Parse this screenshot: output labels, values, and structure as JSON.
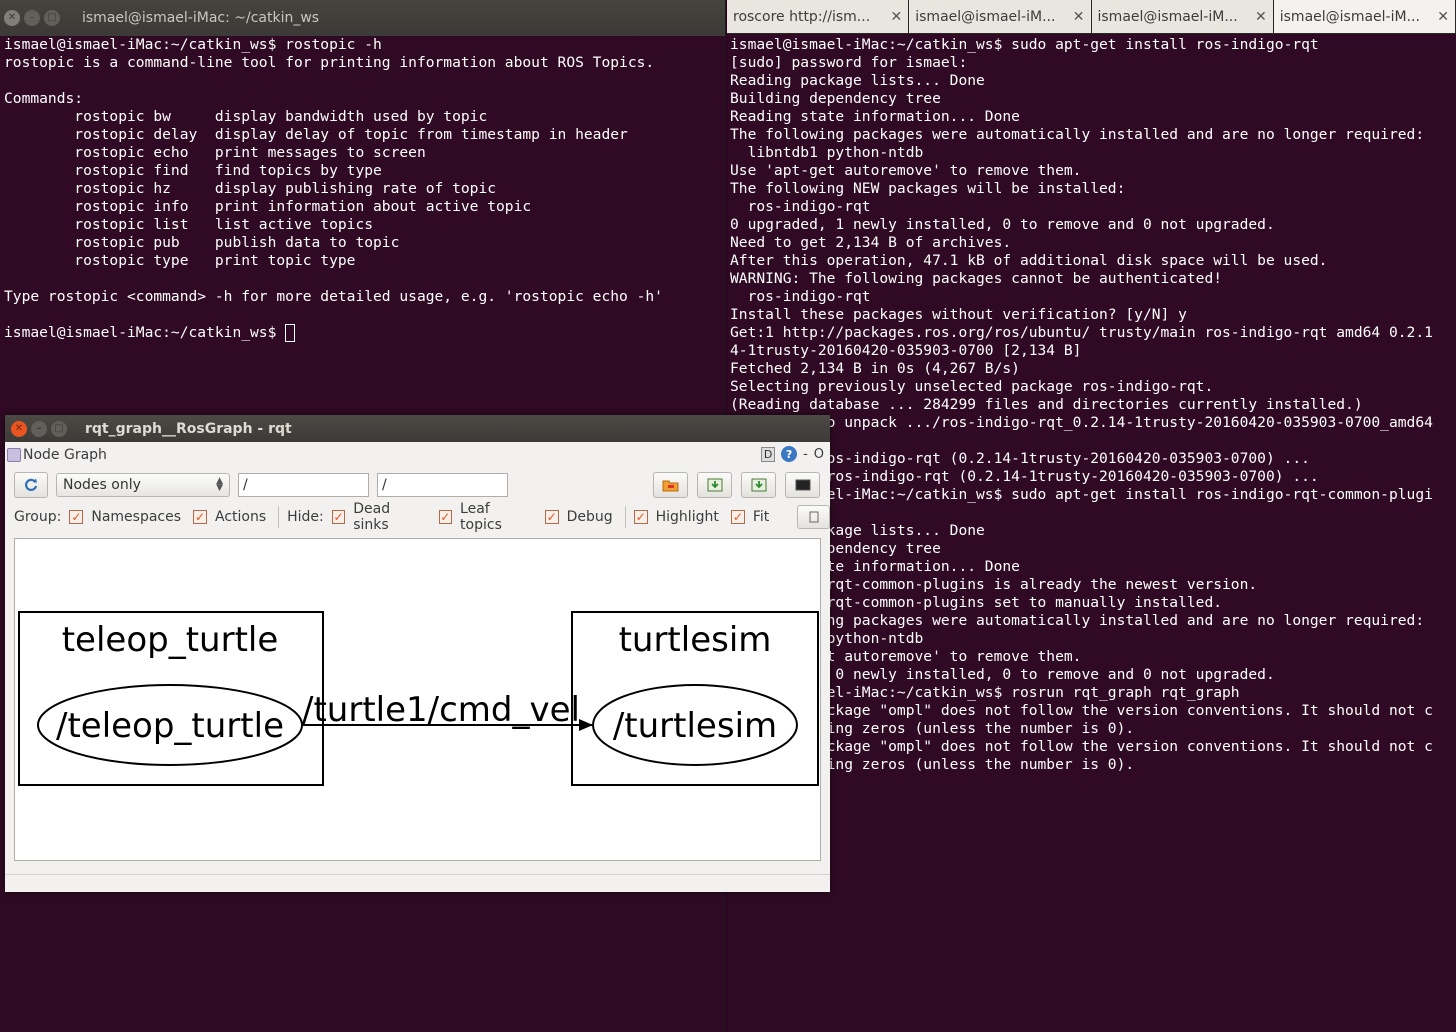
{
  "left_terminal": {
    "title": "ismael@ismael-iMac: ~/catkin_ws",
    "lines": [
      "ismael@ismael-iMac:~/catkin_ws$ rostopic -h",
      "rostopic is a command-line tool for printing information about ROS Topics.",
      "",
      "Commands:",
      "\trostopic bw\tdisplay bandwidth used by topic",
      "\trostopic delay\tdisplay delay of topic from timestamp in header",
      "\trostopic echo\tprint messages to screen",
      "\trostopic find\tfind topics by type",
      "\trostopic hz\tdisplay publishing rate of topic",
      "\trostopic info\tprint information about active topic",
      "\trostopic list\tlist active topics",
      "\trostopic pub\tpublish data to topic",
      "\trostopic type\tprint topic type",
      "",
      "Type rostopic <command> -h for more detailed usage, e.g. 'rostopic echo -h'",
      ""
    ],
    "prompt": "ismael@ismael-iMac:~/catkin_ws$ "
  },
  "right_terminal": {
    "tabs": [
      {
        "label": "roscore http://ism..."
      },
      {
        "label": "ismael@ismael-iM..."
      },
      {
        "label": "ismael@ismael-iM..."
      },
      {
        "label": "ismael@ismael-iM..."
      }
    ],
    "lines": [
      "ismael@ismael-iMac:~/catkin_ws$ sudo apt-get install ros-indigo-rqt",
      "[sudo] password for ismael:",
      "Reading package lists... Done",
      "Building dependency tree",
      "Reading state information... Done",
      "The following packages were automatically installed and are no longer required:",
      "  libntdb1 python-ntdb",
      "Use 'apt-get autoremove' to remove them.",
      "The following NEW packages will be installed:",
      "  ros-indigo-rqt",
      "0 upgraded, 1 newly installed, 0 to remove and 0 not upgraded.",
      "Need to get 2,134 B of archives.",
      "After this operation, 47.1 kB of additional disk space will be used.",
      "WARNING: The following packages cannot be authenticated!",
      "  ros-indigo-rqt",
      "Install these packages without verification? [y/N] y",
      "Get:1 http://packages.ros.org/ros/ubuntu/ trusty/main ros-indigo-rqt amd64 0.2.1",
      "4-1trusty-20160420-035903-0700 [2,134 B]",
      "Fetched 2,134 B in 0s (4,267 B/s)",
      "Selecting previously unselected package ros-indigo-rqt.",
      "(Reading database ... 284299 files and directories currently installed.)",
      "Preparing to unpack .../ros-indigo-rqt_0.2.14-1trusty-20160420-035903-0700_amd64",
      "",
      "Unpacking ros-indigo-rqt (0.2.14-1trusty-20160420-035903-0700) ...",
      "Setting up ros-indigo-rqt (0.2.14-1trusty-20160420-035903-0700) ...",
      "ismael@ismael-iMac:~/catkin_ws$ sudo apt-get install ros-indigo-rqt-common-plugi",
      "",
      "Reading package lists... Done",
      "Building dependency tree",
      "Reading state information... Done",
      "ros-indigo-rqt-common-plugins is already the newest version.",
      "ros-indigo-rqt-common-plugins set to manually installed.",
      "The following packages were automatically installed and are no longer required:",
      "  libntdb1 python-ntdb",
      "Use 'apt-get autoremove' to remove them.",
      "0 upgraded, 0 newly installed, 0 to remove and 0 not upgraded.",
      "ismael@ismael-iMac:~/catkin_ws$ rosrun rqt_graph rqt_graph",
      "WARNING: Package \"ompl\" does not follow the version conventions. It should not c",
      "ontain leading zeros (unless the number is 0).",
      "WARNING: Package \"ompl\" does not follow the version conventions. It should not c",
      "ontain leading zeros (unless the number is 0)."
    ]
  },
  "rqt": {
    "title": "rqt_graph__RosGraph - rqt",
    "plugin_title": "Node Graph",
    "plugin_ctrls": {
      "d": "D",
      "help": "?",
      "minus": "-",
      "o": "O"
    },
    "refresh_icon": "refresh-icon",
    "display_mode": "Nodes only",
    "filter1": "/",
    "filter2": "/",
    "group_label": "Group:",
    "hide_label": "Hide:",
    "checks": {
      "namespaces": "Namespaces",
      "actions": "Actions",
      "dead_sinks": "Dead sinks",
      "leaf_topics": "Leaf topics",
      "debug": "Debug",
      "highlight": "Highlight",
      "fit": "Fit"
    },
    "graph": {
      "node_left_cluster": "teleop_turtle",
      "node_left": "/teleop_turtle",
      "edge_label": "/turtle1/cmd_vel",
      "node_right_cluster": "turtlesim",
      "node_right": "/turtlesim"
    },
    "accent": "#e95420"
  }
}
